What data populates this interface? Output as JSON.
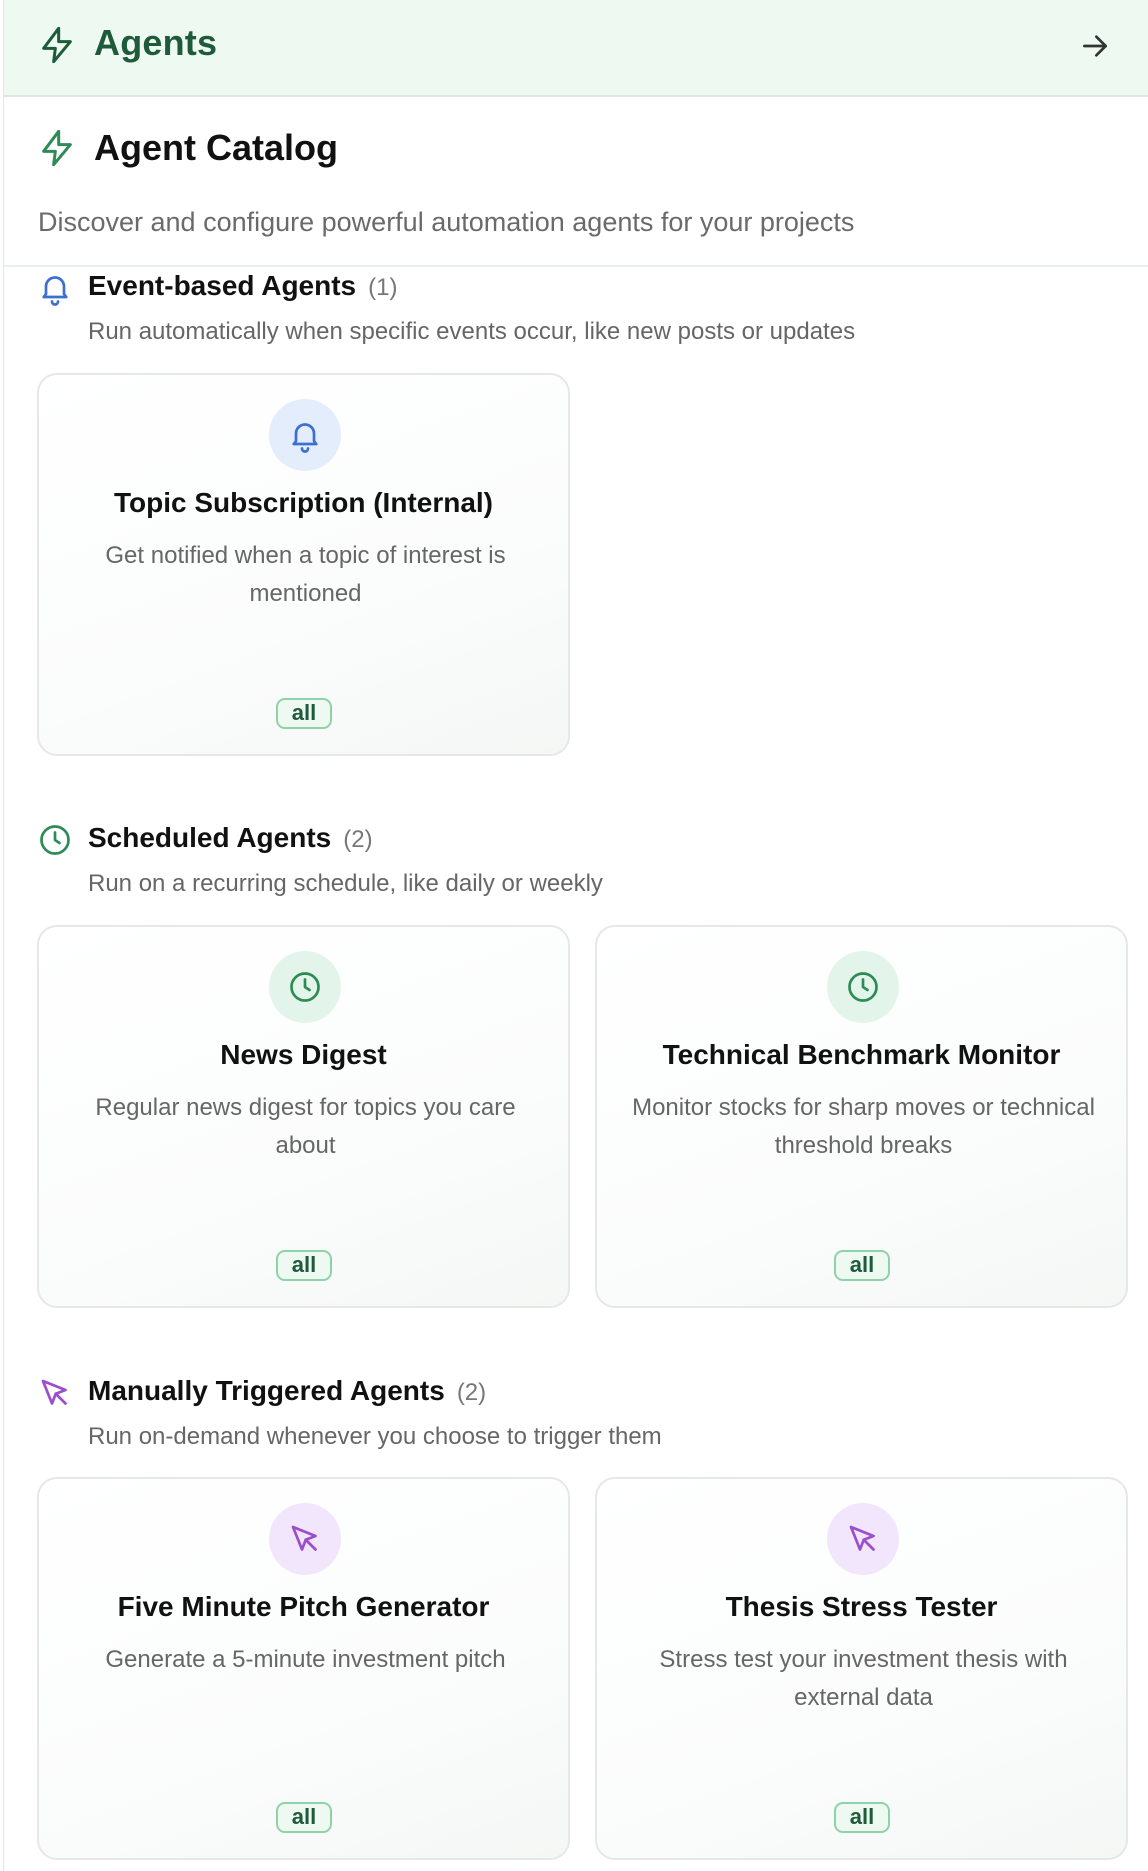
{
  "topbar": {
    "title": "Agents",
    "icon": "lightning-bolt-icon",
    "action_icon": "arrow-right-icon"
  },
  "catalog": {
    "title": "Agent Catalog",
    "subtitle": "Discover and configure powerful automation agents for your projects",
    "icon": "lightning-bolt-icon"
  },
  "colors": {
    "accent_green": "#1f5a3a",
    "badge_border": "#8fd1a8",
    "event_blue": "#3b6fd0",
    "scheduled_green": "#2e8b57",
    "manual_purple": "#9c4dcc"
  },
  "sections": [
    {
      "title": "Event-based Agents",
      "count": "(1)",
      "description": "Run automatically when specific events occur, like new posts or updates",
      "icon": "bell-icon",
      "cards": [
        {
          "name": "Topic Subscription (Internal)",
          "description": "Get notified when a topic of interest is mentioned",
          "badge": "all",
          "icon": "bell-icon"
        }
      ]
    },
    {
      "title": "Scheduled Agents",
      "count": "(2)",
      "description": "Run on a recurring schedule, like daily or weekly",
      "icon": "clock-icon",
      "cards": [
        {
          "name": "News Digest",
          "description": "Regular news digest for topics you care about",
          "badge": "all",
          "icon": "clock-icon"
        },
        {
          "name": "Technical Benchmark Monitor",
          "description": "Monitor stocks for sharp moves or technical threshold breaks",
          "badge": "all",
          "icon": "clock-icon"
        }
      ]
    },
    {
      "title": "Manually Triggered Agents",
      "count": "(2)",
      "description": "Run on-demand whenever you choose to trigger them",
      "icon": "cursor-pointer-icon",
      "cards": [
        {
          "name": "Five Minute Pitch Generator",
          "description": "Generate a 5-minute investment pitch",
          "badge": "all",
          "icon": "cursor-pointer-icon"
        },
        {
          "name": "Thesis Stress Tester",
          "description": "Stress test your investment thesis with external data",
          "badge": "all",
          "icon": "cursor-pointer-icon"
        }
      ]
    }
  ]
}
